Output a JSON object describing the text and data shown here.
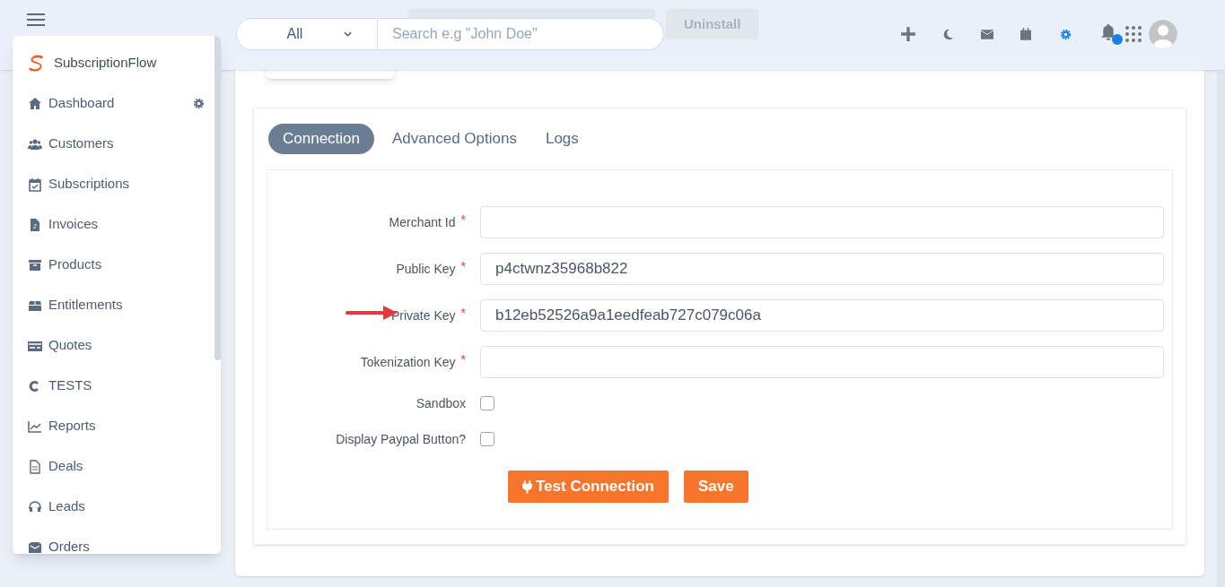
{
  "header": {
    "search_scope": "All",
    "search": {
      "placeholder": "Search e.g \"John Doe\""
    },
    "behind_button": "Uninstall",
    "notification_dot": true
  },
  "sidebar": {
    "brand": "SubscriptionFlow",
    "items": [
      {
        "label": "Dashboard",
        "settings": true
      },
      {
        "label": "Customers",
        "settings": false
      },
      {
        "label": "Subscriptions",
        "settings": false
      },
      {
        "label": "Invoices",
        "settings": false
      },
      {
        "label": "Products",
        "settings": false
      },
      {
        "label": "Entitlements",
        "settings": false
      },
      {
        "label": "Quotes",
        "settings": false
      },
      {
        "label": "TESTS",
        "settings": false
      },
      {
        "label": "Reports",
        "settings": false
      },
      {
        "label": "Deals",
        "settings": false
      },
      {
        "label": "Leads",
        "settings": false
      },
      {
        "label": "Orders",
        "settings": false
      }
    ]
  },
  "tabs": [
    {
      "label": "Connection",
      "selected": true
    },
    {
      "label": "Advanced Options",
      "selected": false
    },
    {
      "label": "Logs",
      "selected": false
    }
  ],
  "form": {
    "fields": [
      {
        "kind": "text",
        "label": "Merchant Id",
        "required_mark": "*"
      },
      {
        "kind": "text",
        "label": "Public Key",
        "required_mark": "*",
        "value": "p4ctwnz35968b822"
      },
      {
        "kind": "text",
        "label": "Private Key",
        "required_mark": "*",
        "value": "b12eb52526a9a1eedfeab727c079c06a",
        "annotated": true
      },
      {
        "kind": "text",
        "label": "Tokenization Key",
        "required_mark": "*"
      },
      {
        "kind": "checkbox",
        "label": "Sandbox",
        "checked": false
      },
      {
        "kind": "checkbox",
        "label": "Display Paypal Button?",
        "checked": false
      }
    ],
    "buttons": [
      "Test Connection",
      "Save"
    ]
  }
}
